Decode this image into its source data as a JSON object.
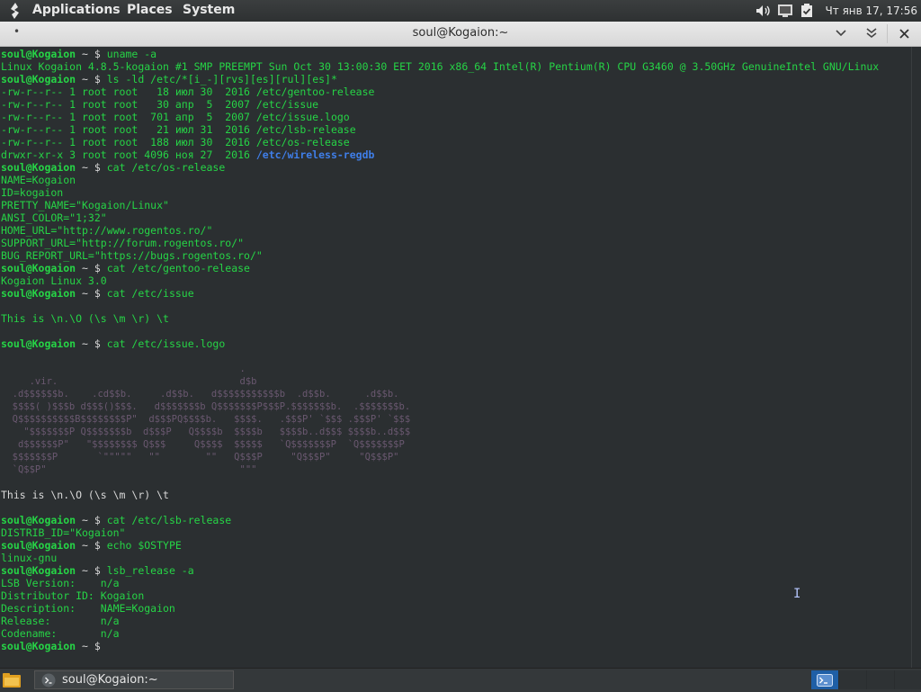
{
  "top_panel": {
    "menus": [
      "Applications",
      "Places",
      "System"
    ],
    "clock": "Чт янв 17, 17:56",
    "icons": [
      "distro-logo-icon",
      "volume-icon",
      "network-icon",
      "clipboard-check-icon"
    ]
  },
  "window": {
    "title": "soul@Kogaion:~",
    "menu_dot": "•",
    "buttons": [
      "chevron-down-icon",
      "double-chevron-down-icon",
      "close-icon"
    ]
  },
  "terminal": {
    "prompt_user": "soul@Kogaion",
    "prompt_tail": " ~ $ ",
    "lines": [
      {
        "t": "prompt",
        "cmd": "uname -a"
      },
      {
        "t": "out",
        "text": "Linux Kogaion 4.8.5-kogaion #1 SMP PREEMPT Sun Oct 30 13:00:30 EET 2016 x86_64 Intel(R) Pentium(R) CPU G3460 @ 3.50GHz GenuineIntel GNU/Linux"
      },
      {
        "t": "prompt",
        "cmd": "ls -ld /etc/*[i_-][rvs][es][rul][es]*"
      },
      {
        "t": "out",
        "text": "-rw-r--r-- 1 root root   18 июл 30  2016 /etc/gentoo-release"
      },
      {
        "t": "out",
        "text": "-rw-r--r-- 1 root root   30 апр  5  2007 /etc/issue"
      },
      {
        "t": "out",
        "text": "-rw-r--r-- 1 root root  701 апр  5  2007 /etc/issue.logo"
      },
      {
        "t": "out",
        "text": "-rw-r--r-- 1 root root   21 июл 31  2016 /etc/lsb-release"
      },
      {
        "t": "out",
        "text": "-rw-r--r-- 1 root root  188 июл 30  2016 /etc/os-release"
      },
      {
        "t": "dir",
        "text": "drwxr-xr-x 3 root root 4096 ноя 27  2016 ",
        "dir": "/etc/wireless-regdb"
      },
      {
        "t": "prompt",
        "cmd": "cat /etc/os-release"
      },
      {
        "t": "out",
        "text": "NAME=Kogaion"
      },
      {
        "t": "out",
        "text": "ID=kogaion"
      },
      {
        "t": "out",
        "text": "PRETTY_NAME=\"Kogaion/Linux\""
      },
      {
        "t": "out",
        "text": "ANSI_COLOR=\"1;32\""
      },
      {
        "t": "out",
        "text": "HOME_URL=\"http://www.rogentos.ro/\""
      },
      {
        "t": "out",
        "text": "SUPPORT_URL=\"http://forum.rogentos.ro/\""
      },
      {
        "t": "out",
        "text": "BUG_REPORT_URL=\"https://bugs.rogentos.ro/\""
      },
      {
        "t": "prompt",
        "cmd": "cat /etc/gentoo-release"
      },
      {
        "t": "out",
        "text": "Kogaion Linux 3.0"
      },
      {
        "t": "prompt",
        "cmd": "cat /etc/issue"
      },
      {
        "t": "out",
        "text": ""
      },
      {
        "t": "out",
        "text": "This is \\n.\\O (\\s \\m \\r) \\t"
      },
      {
        "t": "out",
        "text": ""
      },
      {
        "t": "prompt",
        "cmd": "cat /etc/issue.logo"
      },
      {
        "t": "out",
        "text": ""
      },
      {
        "t": "logo",
        "text": "                                          ."
      },
      {
        "t": "logo",
        "text": "     .vir.                                d$b"
      },
      {
        "t": "logo",
        "text": "  .d$$$$$$b.    .cd$$b.     .d$$b.   d$$$$$$$$$$$b  .d$$b.      .d$$b."
      },
      {
        "t": "logo",
        "text": "  $$$$( )$$$b d$$$()$$$.   d$$$$$$$b Q$$$$$$$P$$$P.$$$$$$$b.  .$$$$$$$b."
      },
      {
        "t": "logo",
        "text": "  Q$$$$$$$$$$B$$$$$$$$P\"  d$$$PQ$$$$b.   $$$$.   .$$$P' `$$$ .$$$P' `$$$"
      },
      {
        "t": "logo",
        "text": "    \"$$$$$$$P Q$$$$$$$b  d$$$P   Q$$$$b  $$$$b   $$$$b..d$$$ $$$$b..d$$$"
      },
      {
        "t": "logo",
        "text": "   d$$$$$$P\"   \"$$$$$$$$ Q$$$     Q$$$$  $$$$$   `Q$$$$$$$P  `Q$$$$$$$P"
      },
      {
        "t": "logo",
        "text": "  $$$$$$$P       `\"\"\"\"\"   \"\"        \"\"   Q$$$P     \"Q$$$P\"     \"Q$$$P\""
      },
      {
        "t": "logo",
        "text": "  `Q$$P\"                                  \"\"\""
      },
      {
        "t": "out",
        "text": ""
      },
      {
        "t": "white",
        "text": "This is \\n.\\O (\\s \\m \\r) \\t"
      },
      {
        "t": "out",
        "text": ""
      },
      {
        "t": "prompt",
        "cmd": "cat /etc/lsb-release"
      },
      {
        "t": "out",
        "text": "DISTRIB_ID=\"Kogaion\""
      },
      {
        "t": "prompt",
        "cmd": "echo $OSTYPE"
      },
      {
        "t": "out",
        "text": "linux-gnu"
      },
      {
        "t": "prompt",
        "cmd": "lsb_release -a"
      },
      {
        "t": "out",
        "text": "LSB Version:    n/a"
      },
      {
        "t": "out",
        "text": "Distributor ID: Kogaion"
      },
      {
        "t": "out",
        "text": "Description:    NAME=Kogaion"
      },
      {
        "t": "out",
        "text": "Release:        n/a"
      },
      {
        "t": "out",
        "text": "Codename:       n/a"
      },
      {
        "t": "prompt",
        "cmd": ""
      }
    ]
  },
  "bottom_panel": {
    "task_label": "soul@Kogaion:~",
    "workspace_count": 4,
    "active_workspace": 1
  },
  "colors": {
    "terminal_bg": "#2b2f31",
    "terminal_fg": "#26d446",
    "dir": "#3f7ee8",
    "workspace_active": "#1f5fa6"
  }
}
